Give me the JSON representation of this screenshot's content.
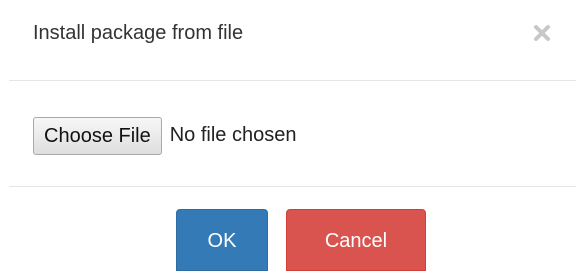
{
  "dialog": {
    "title": "Install package from file",
    "close_icon": "close-icon"
  },
  "file_input": {
    "button_label": "Choose File",
    "status_text": "No file chosen"
  },
  "footer": {
    "ok_label": "OK",
    "cancel_label": "Cancel"
  },
  "colors": {
    "primary": "#337ab7",
    "danger": "#d9534f",
    "divider": "#e5e5e5",
    "close_icon": "#c8c8c8"
  }
}
